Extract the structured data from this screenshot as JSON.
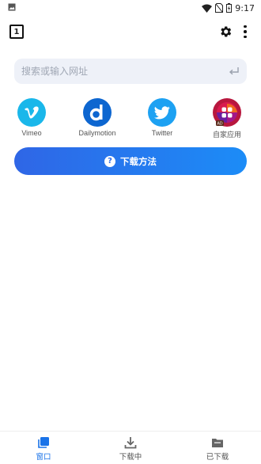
{
  "status_bar": {
    "time": "9:17"
  },
  "top_bar": {
    "tab_count": "1"
  },
  "search": {
    "placeholder": "搜索或输入网址"
  },
  "quick_sites": [
    {
      "label": "Vimeo",
      "icon": "vimeo-icon",
      "color": "#1ab7ea"
    },
    {
      "label": "Dailymotion",
      "icon": "dailymotion-icon",
      "color": "#0d66d0"
    },
    {
      "label": "Twitter",
      "icon": "twitter-icon",
      "color": "#1da1f2"
    },
    {
      "label": "自家应用",
      "icon": "app-grid-icon",
      "color": "#b8173e",
      "badge": "AD"
    }
  ],
  "download_help": {
    "label": "下载方法"
  },
  "bottom_nav": [
    {
      "label": "窗口",
      "icon": "window-icon",
      "active": true
    },
    {
      "label": "下载中",
      "icon": "download-icon",
      "active": false
    },
    {
      "label": "已下载",
      "icon": "folder-icon",
      "active": false
    }
  ],
  "colors": {
    "accent": "#1a73e8",
    "button_gradient_start": "#2f66e6",
    "button_gradient_end": "#1c8cf7",
    "search_bg": "#eef1f8"
  }
}
